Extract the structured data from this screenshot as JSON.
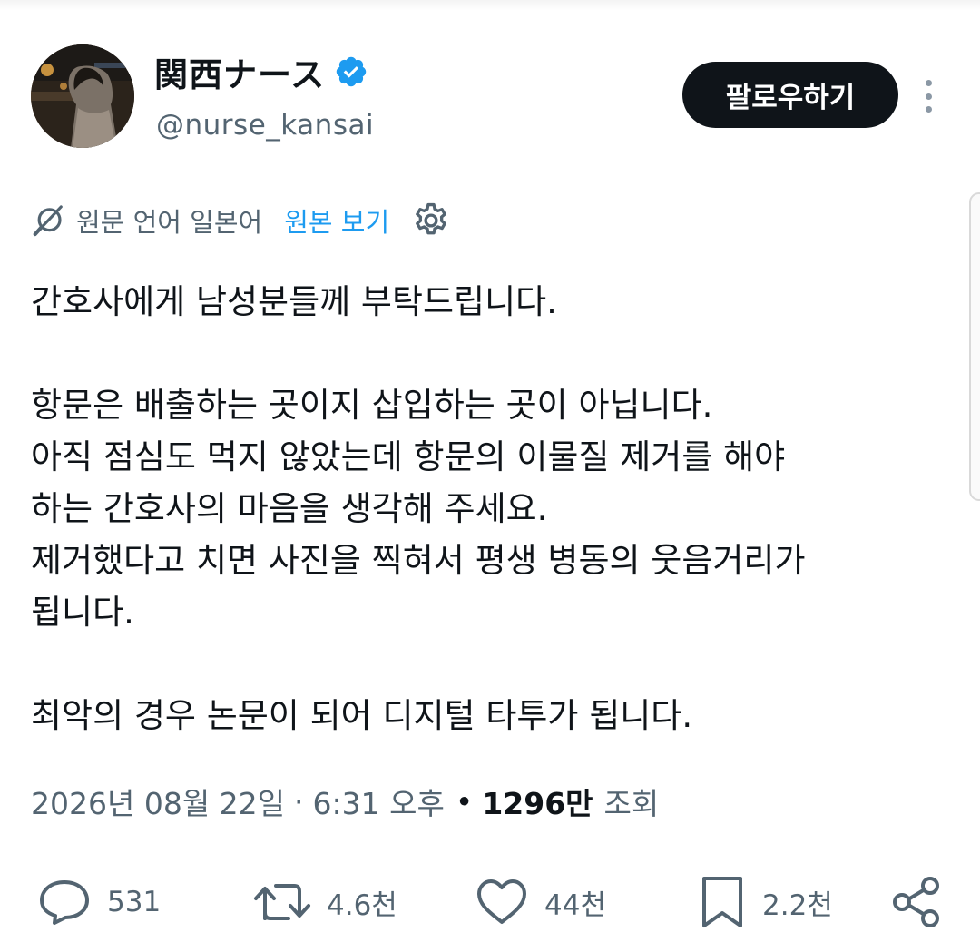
{
  "profile": {
    "display_name": "関西ナース",
    "handle": "@nurse_kansai",
    "verified": true,
    "avatar_icon": "profile-photo"
  },
  "header": {
    "follow_label": "팔로우하기",
    "more_icon": "more-vertical-icon"
  },
  "translation": {
    "status_text": "원문 언어 일본어",
    "view_original_label": "원본 보기",
    "icon": "translate-icon",
    "settings_icon": "gear-icon"
  },
  "tweet": {
    "lines": [
      "간호사에게 남성분들께 부탁드립니다.",
      "",
      "항문은 배출하는 곳이지 삽입하는 곳이 아닙니다.",
      "아직 점심도 먹지 않았는데 항문의 이물질 제거를 해야",
      "하는 간호사의 마음을 생각해 주세요.",
      "제거했다고 치면 사진을 찍혀서 평생 병동의 웃음거리가",
      "됩니다.",
      "",
      "최악의 경우 논문이 되어 디지털 타투가 됩니다."
    ]
  },
  "meta": {
    "date": "2026년 08월 22일",
    "separator1": "·",
    "time": "6:31 오후",
    "separator2": "•",
    "views": "1296만",
    "views_label": "조회"
  },
  "actions": {
    "reply_count": "531",
    "retweet_count": "4.6천",
    "like_count": "44천",
    "bookmark_count": "2.2천"
  },
  "colors": {
    "text": "#0f1419",
    "secondary": "#536471",
    "accent": "#1d9bf0",
    "follow_bg": "#0f1419"
  }
}
